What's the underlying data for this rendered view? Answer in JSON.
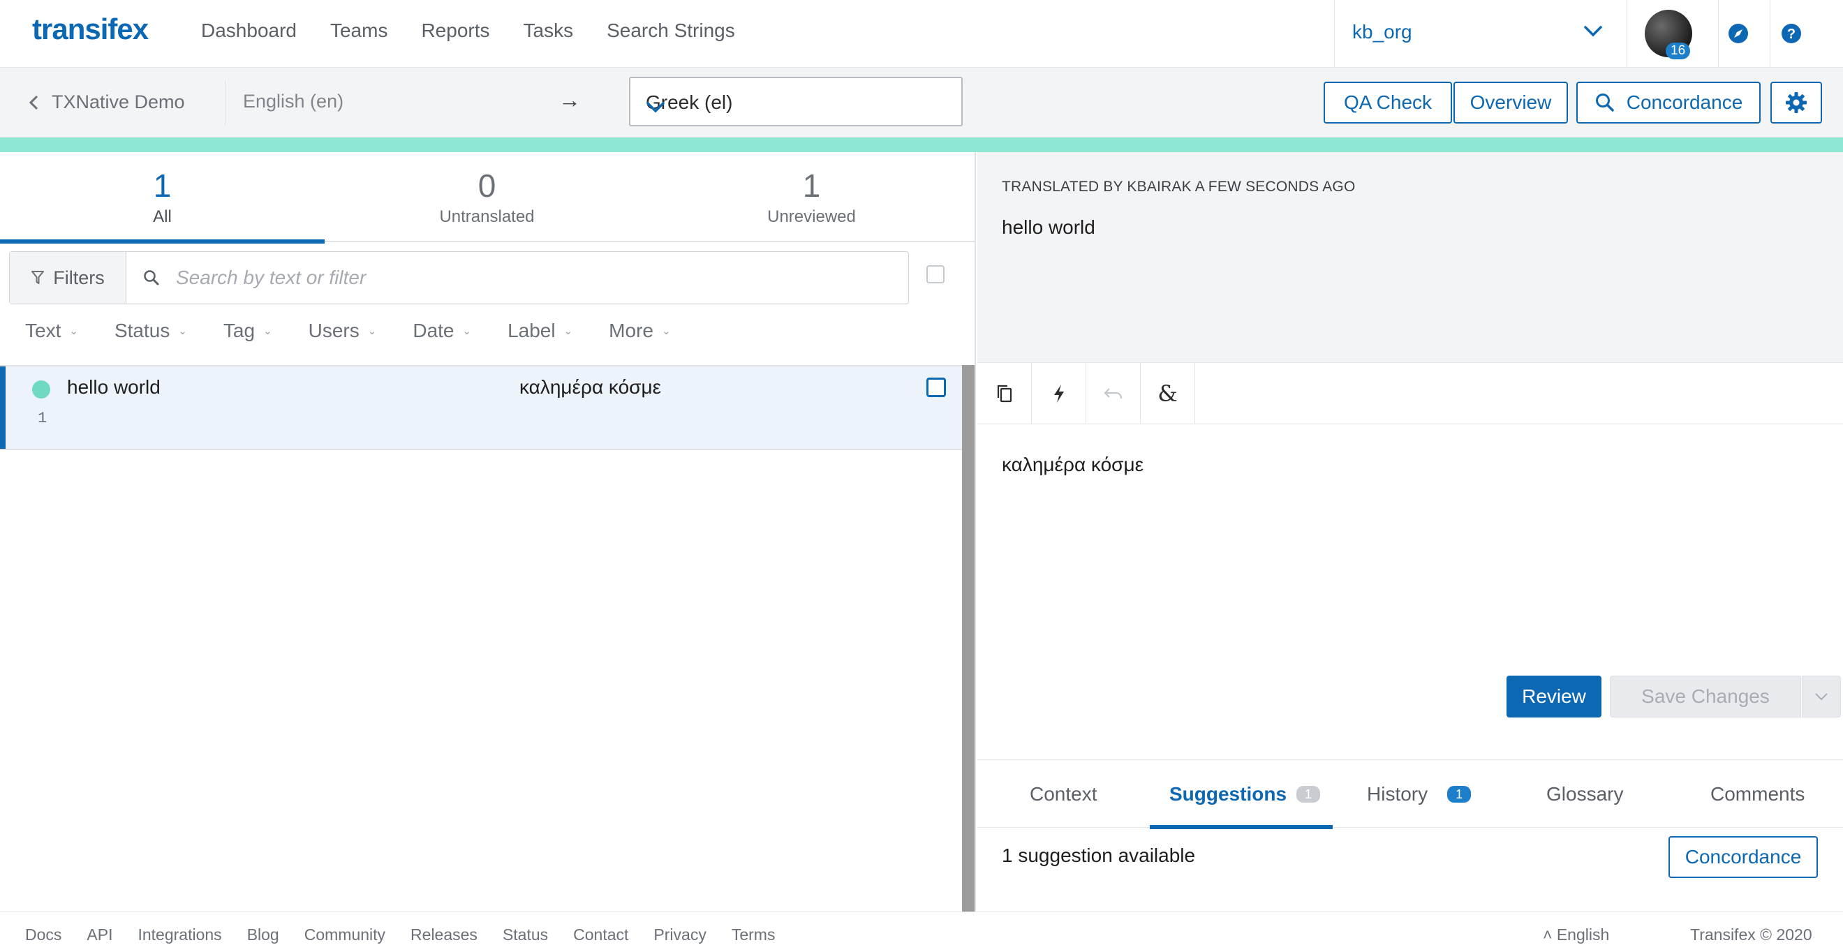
{
  "app": {
    "logo": "transifex"
  },
  "nav": {
    "items": [
      {
        "label": "Dashboard"
      },
      {
        "label": "Teams"
      },
      {
        "label": "Reports"
      },
      {
        "label": "Tasks"
      },
      {
        "label": "Search Strings"
      }
    ]
  },
  "org": {
    "name": "kb_org",
    "notifications": "16"
  },
  "subbar": {
    "project": "TXNative Demo",
    "source_language": "English (en)",
    "arrow": "→",
    "target_language": "Greek (el)",
    "qa_check": "QA Check",
    "overview": "Overview",
    "concordance": "Concordance"
  },
  "colors": {
    "brand": "#0d68b3",
    "progress": "#8fe6d2",
    "translated_dot": "#6fd9c2"
  },
  "tabs": [
    {
      "count": "1",
      "label": "All"
    },
    {
      "count": "0",
      "label": "Untranslated"
    },
    {
      "count": "1",
      "label": "Unreviewed"
    }
  ],
  "filters": {
    "button": "Filters",
    "search_placeholder": "Search by text or filter"
  },
  "sort": {
    "items": [
      {
        "label": "Text"
      },
      {
        "label": "Status"
      },
      {
        "label": "Tag"
      },
      {
        "label": "Users"
      },
      {
        "label": "Date"
      },
      {
        "label": "Label"
      },
      {
        "label": "More"
      }
    ]
  },
  "strings": [
    {
      "source": "hello world",
      "translation": "καλημέρα κόσμε",
      "index": "1"
    }
  ],
  "editor": {
    "meta": "TRANSLATED BY KBAIRAK A FEW SECONDS AGO",
    "source_text": "hello world",
    "translation": "καλημέρα κόσμε",
    "review": "Review",
    "save": "Save Changes"
  },
  "bottom_tabs": {
    "context": "Context",
    "suggestions": "Suggestions",
    "suggestions_count": "1",
    "history": "History",
    "history_count": "1",
    "glossary": "Glossary",
    "comments": "Comments"
  },
  "suggestions": {
    "text": "1 suggestion available",
    "concordance": "Concordance"
  },
  "footer": {
    "links": [
      {
        "label": "Docs"
      },
      {
        "label": "API"
      },
      {
        "label": "Integrations"
      },
      {
        "label": "Blog"
      },
      {
        "label": "Community"
      },
      {
        "label": "Releases"
      },
      {
        "label": "Status"
      },
      {
        "label": "Contact"
      },
      {
        "label": "Privacy"
      },
      {
        "label": "Terms"
      }
    ],
    "language": "˄ English",
    "copyright": "Transifex © 2020"
  }
}
